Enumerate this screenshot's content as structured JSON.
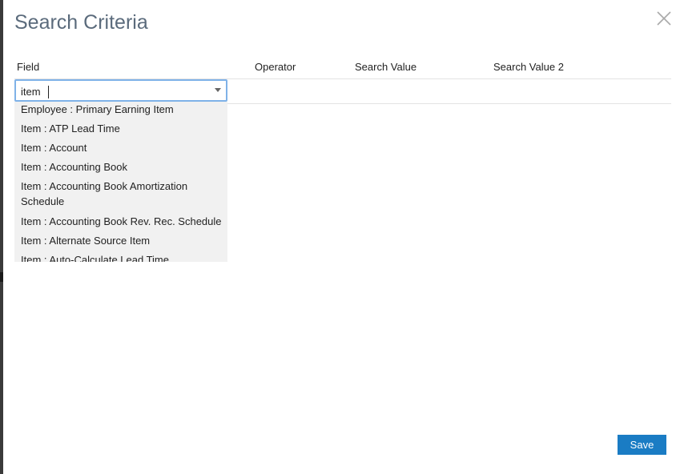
{
  "dialog": {
    "title": "Search Criteria"
  },
  "columns": {
    "field": "Field",
    "operator": "Operator",
    "search_value": "Search Value",
    "search_value_2": "Search Value 2"
  },
  "field_input": {
    "value": "item"
  },
  "dropdown": {
    "items": [
      "Employee : Primary Earning Item",
      "Item : ATP Lead Time",
      "Item : Account",
      "Item : Accounting Book",
      "Item : Accounting Book Amortization Schedule",
      "Item : Accounting Book Rev. Rec. Schedule",
      "Item : Alternate Source Item",
      "Item : Auto-Calculate Lead Time"
    ]
  },
  "footer": {
    "save_label": "Save"
  },
  "icons": {
    "close": "close-icon",
    "dropdown_arrow": "chevron-down-icon"
  },
  "colors": {
    "title": "#5b6b7c",
    "accent": "#1a7cc4",
    "focus_border": "#7fb2e8",
    "dropdown_bg": "#f1f1f1"
  }
}
